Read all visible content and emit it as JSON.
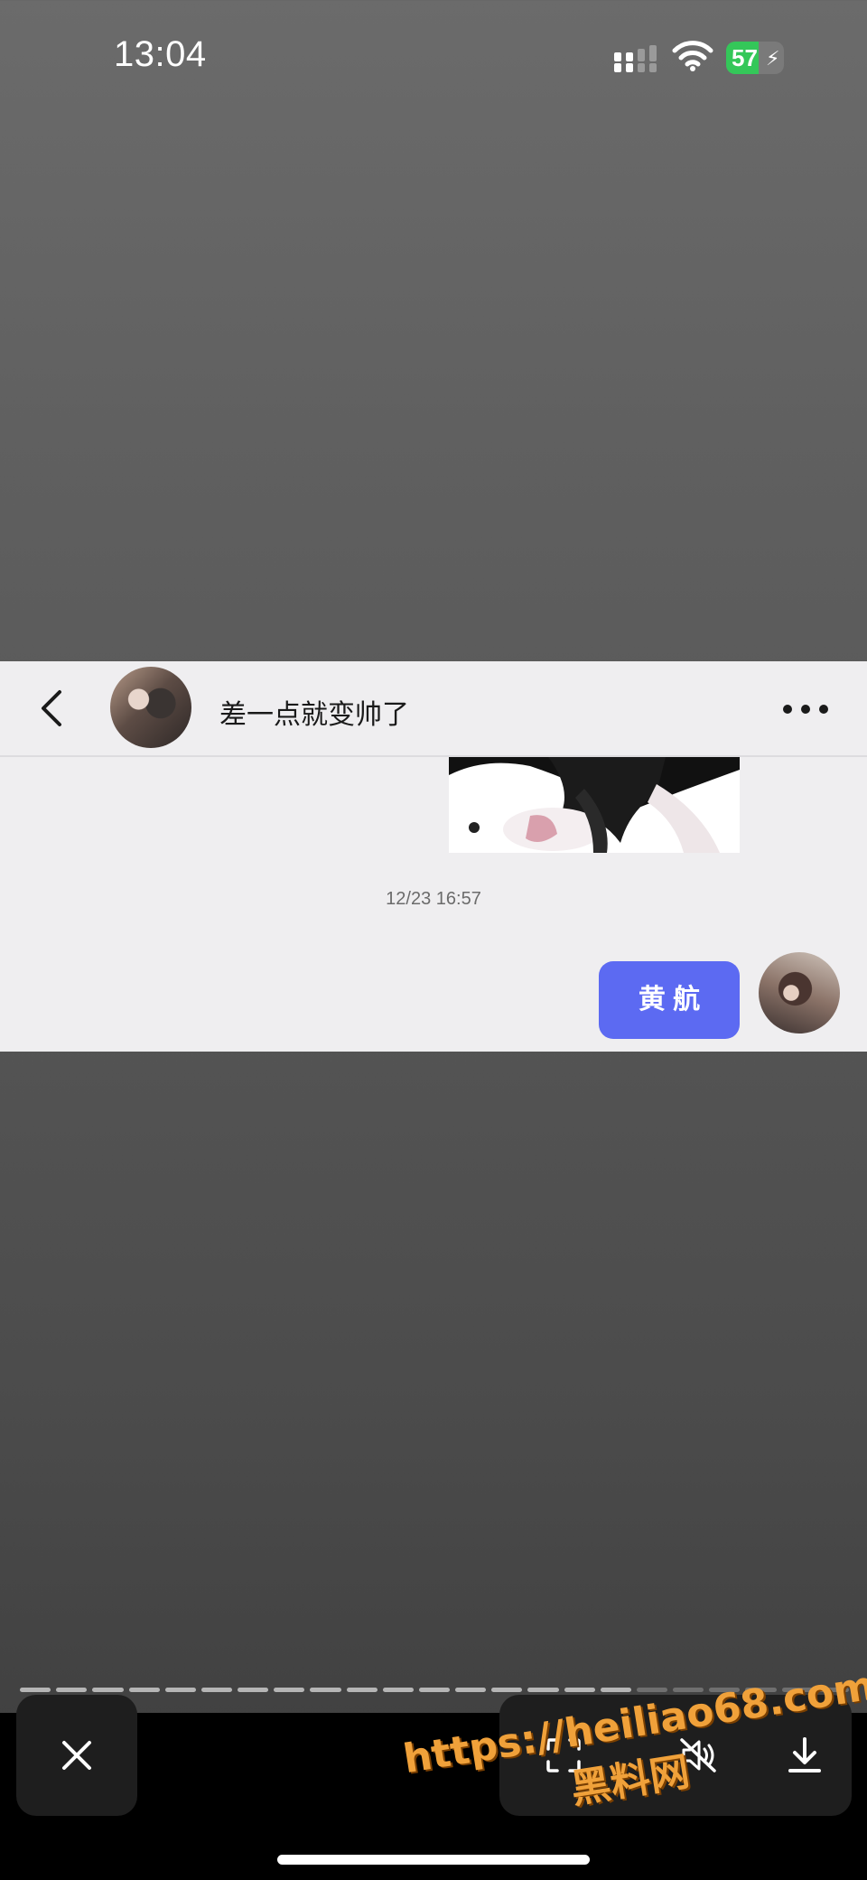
{
  "status_bar": {
    "time": "13:04",
    "battery_level": "57",
    "battery_percent": 57,
    "icons": [
      "signal-icon",
      "wifi-icon",
      "battery-charging-icon"
    ]
  },
  "chat": {
    "title": "差一点就变帅了",
    "timestamp": "12/23 16:57",
    "bubble_text": "黄 航",
    "bubble_color": "#5c6af2"
  },
  "viewer": {
    "progress_total": 23,
    "progress_done": 17,
    "icons": [
      "close-icon",
      "scan-icon",
      "mute-icon",
      "download-icon"
    ]
  },
  "watermark": {
    "url": "https://heiliao68.com",
    "name": "黑料网"
  }
}
